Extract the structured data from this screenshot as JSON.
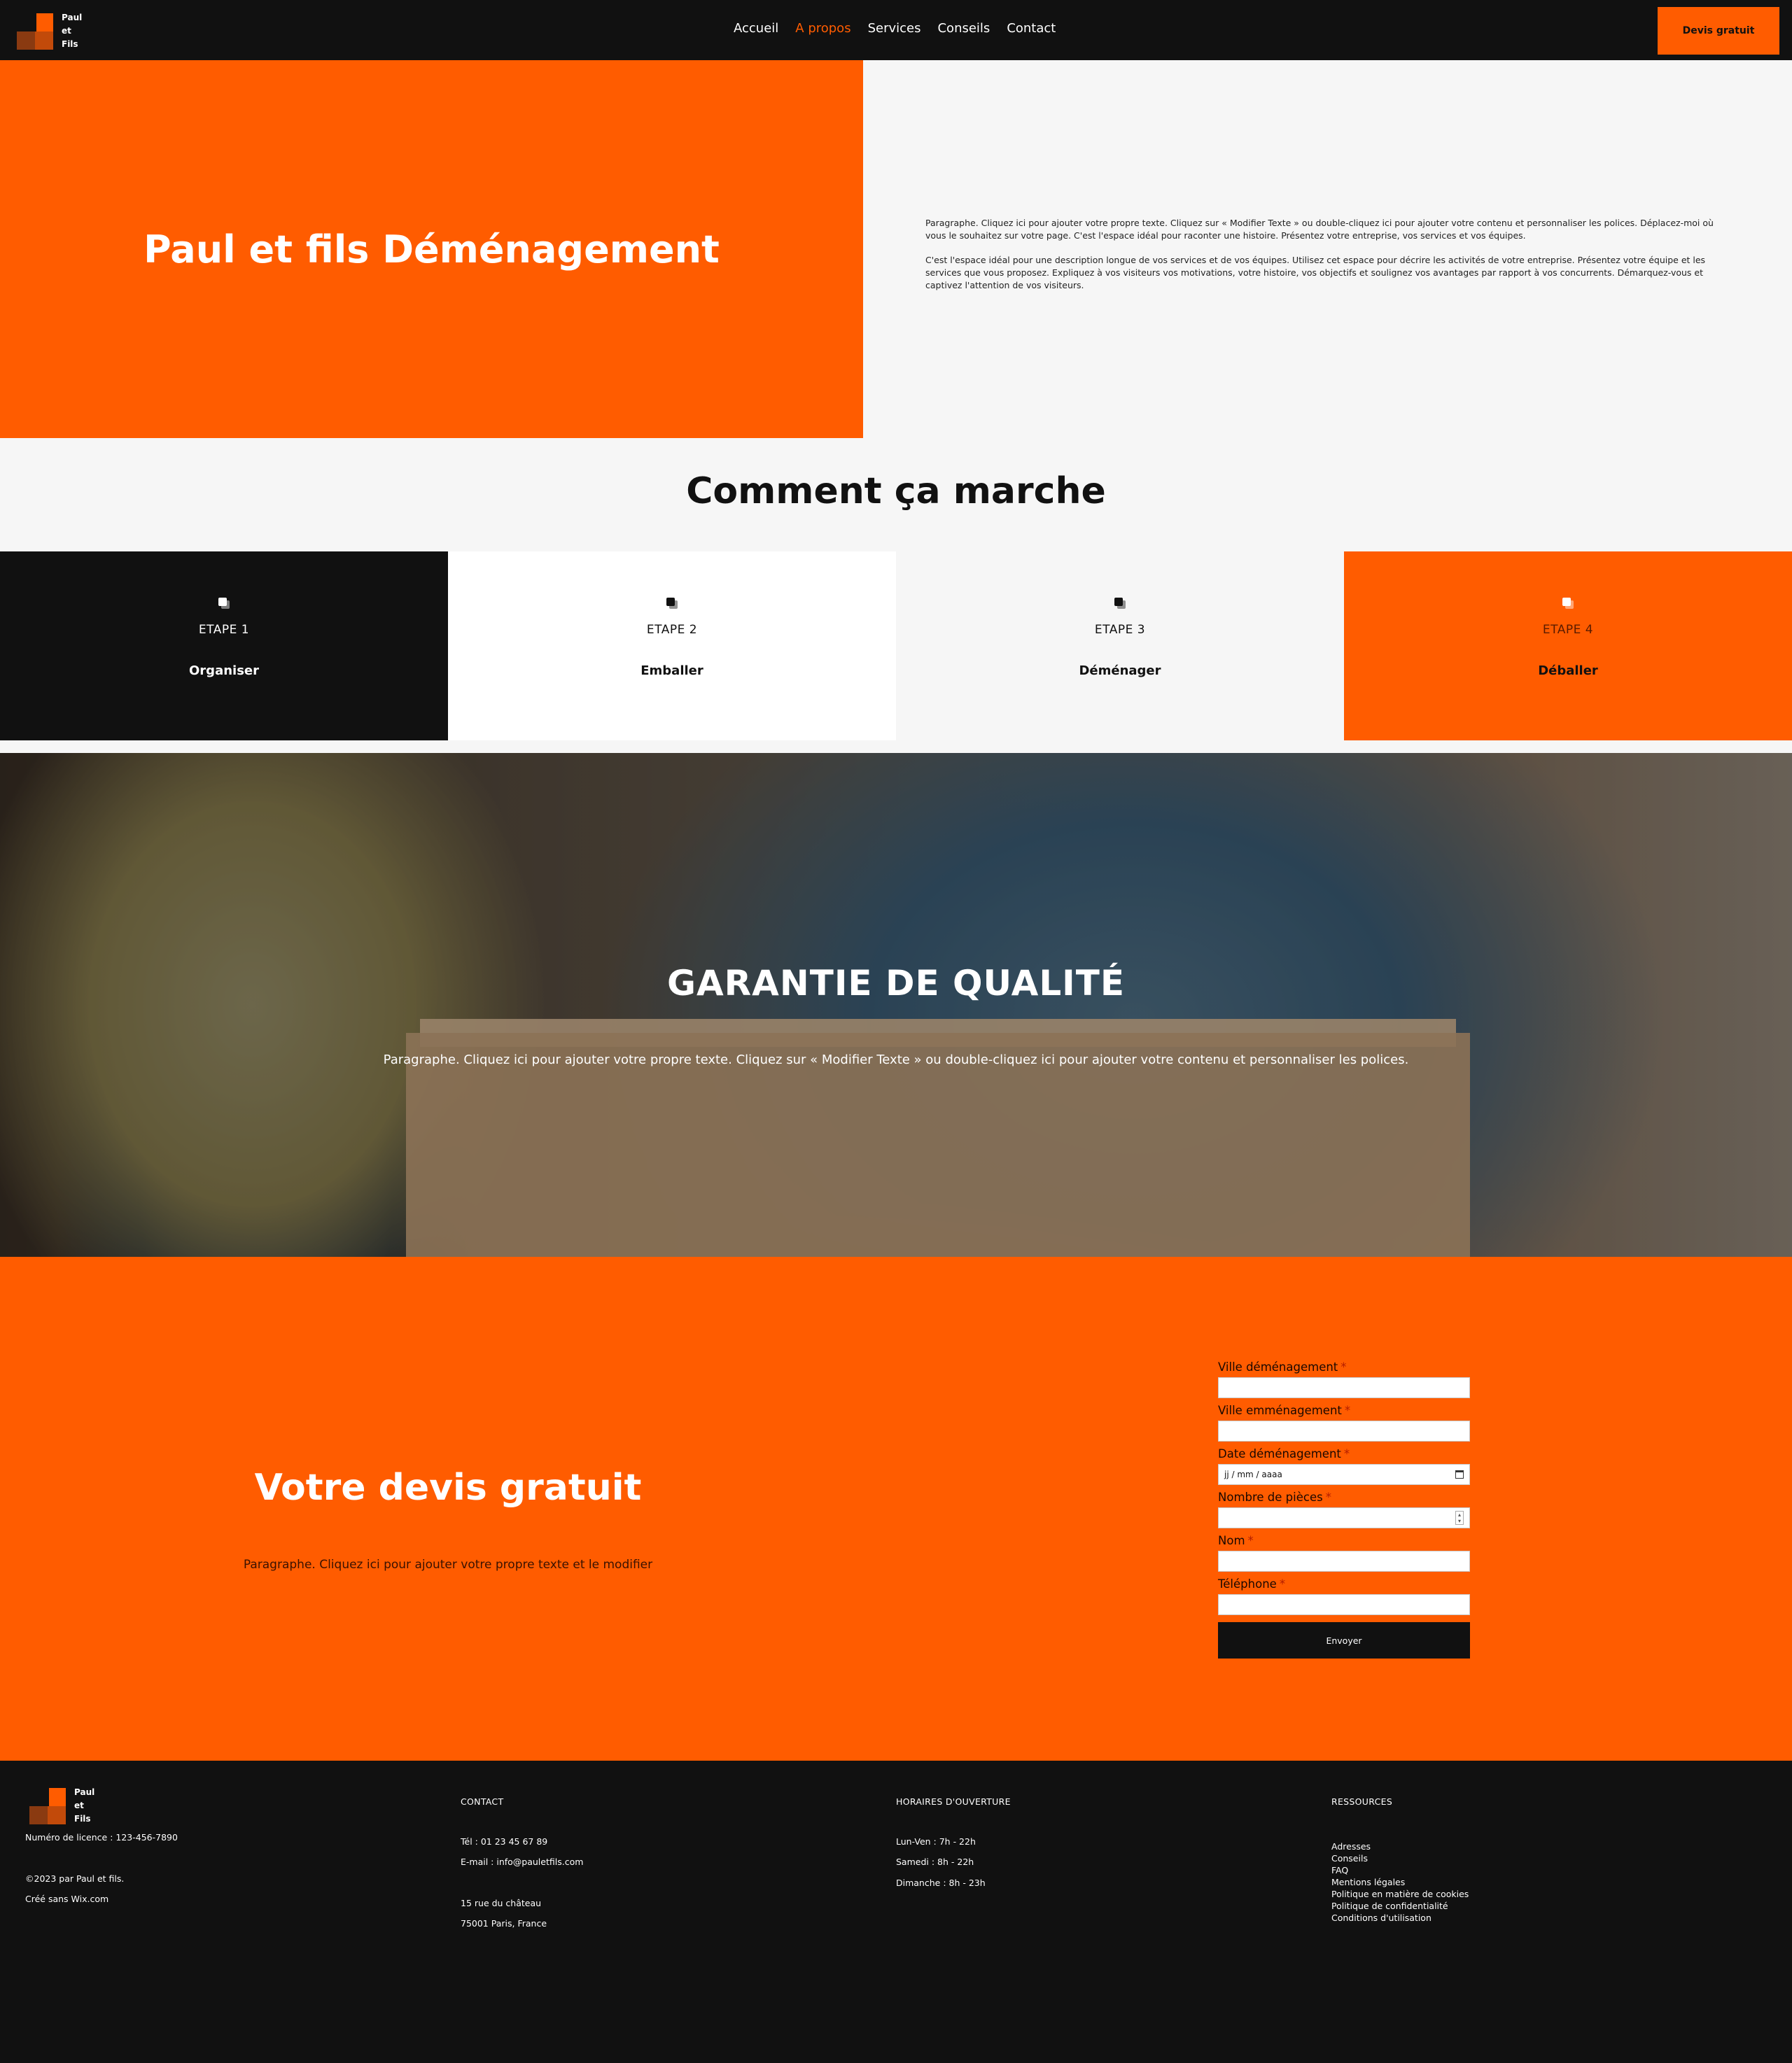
{
  "header": {
    "logo_lines": [
      "Paul",
      "et",
      "Fils"
    ],
    "nav": [
      {
        "label": "Accueil",
        "active": false
      },
      {
        "label": "A propos",
        "active": true
      },
      {
        "label": "Services",
        "active": false
      },
      {
        "label": "Conseils",
        "active": false
      },
      {
        "label": "Contact",
        "active": false
      }
    ],
    "cta": "Devis gratuit"
  },
  "hero": {
    "title": "Paul et fils Déménagement",
    "paragraph1": "Paragraphe. Cliquez ici pour ajouter votre propre texte. Cliquez sur « Modifier Texte » ou double-cliquez ici pour ajouter votre contenu et personnaliser les polices. Déplacez-moi où vous le souhaitez sur votre page. C'est l'espace idéal pour raconter une histoire. Présentez votre entreprise, vos services et vos équipes.",
    "paragraph2": "C'est l'espace idéal pour une description longue de vos services et de vos équipes. Utilisez cet espace pour décrire les activités de votre entreprise. Présentez votre équipe et les services que vous proposez. Expliquez à vos visiteurs vos motivations, votre histoire, vos objectifs et soulignez vos avantages par rapport à vos concurrents. Démarquez-vous et captivez l'attention de vos visiteurs."
  },
  "steps": {
    "title": "Comment ça marche",
    "items": [
      {
        "number": "ETAPE 1",
        "name": "Organiser"
      },
      {
        "number": "ETAPE 2",
        "name": "Emballer"
      },
      {
        "number": "ETAPE 3",
        "name": "Déménager"
      },
      {
        "number": "ETAPE 4",
        "name": "Déballer"
      }
    ]
  },
  "quality": {
    "title": "GARANTIE DE QUALITÉ",
    "paragraph": "Paragraphe. Cliquez ici pour ajouter votre propre texte. Cliquez sur « Modifier Texte » ou double-cliquez ici pour ajouter votre contenu et personnaliser les polices."
  },
  "quote": {
    "title": "Votre devis gratuit",
    "paragraph": "Paragraphe. Cliquez ici pour ajouter votre propre texte et le modifier",
    "fields": [
      {
        "label": "Ville déménagement",
        "required": "*",
        "value": ""
      },
      {
        "label": "Ville emménagement",
        "required": "*",
        "value": ""
      },
      {
        "label": "Date déménagement",
        "required": "*",
        "value": "jj / mm / aaaa"
      },
      {
        "label": "Nombre de pièces",
        "required": "*",
        "value": ""
      },
      {
        "label": "Nom",
        "required": "*",
        "value": ""
      },
      {
        "label": "Téléphone",
        "required": "*",
        "value": ""
      }
    ],
    "submit": "Envoyer"
  },
  "footer": {
    "logo_lines": [
      "Paul",
      "et",
      "Fils"
    ],
    "license": "Numéro de licence : 123-456-7890",
    "copyright": "©2023 par Paul et fils.",
    "created": "Créé sans Wix.com",
    "contact_heading": "CONTACT",
    "phone": "Tél : 01 23 45 67 89",
    "email": "E-mail : info@pauletfils.com",
    "address1": "15 rue du château",
    "address2": "75001 Paris, France",
    "hours_heading": "HORAIRES D'OUVERTURE",
    "hours": [
      "Lun-Ven : 7h - 22h",
      "Samedi : 8h - 22h",
      "Dimanche : 8h - 23h"
    ],
    "resources_heading": "RESSOURCES",
    "resources": [
      "Adresses",
      "Conseils",
      "FAQ",
      "Mentions légales",
      "Politique en matière de cookies",
      "Politique de confidentialité",
      "Conditions d'utilisation"
    ]
  },
  "colors": {
    "accent": "#ff5c00",
    "dark": "#111111",
    "light": "#f6f6f6"
  }
}
